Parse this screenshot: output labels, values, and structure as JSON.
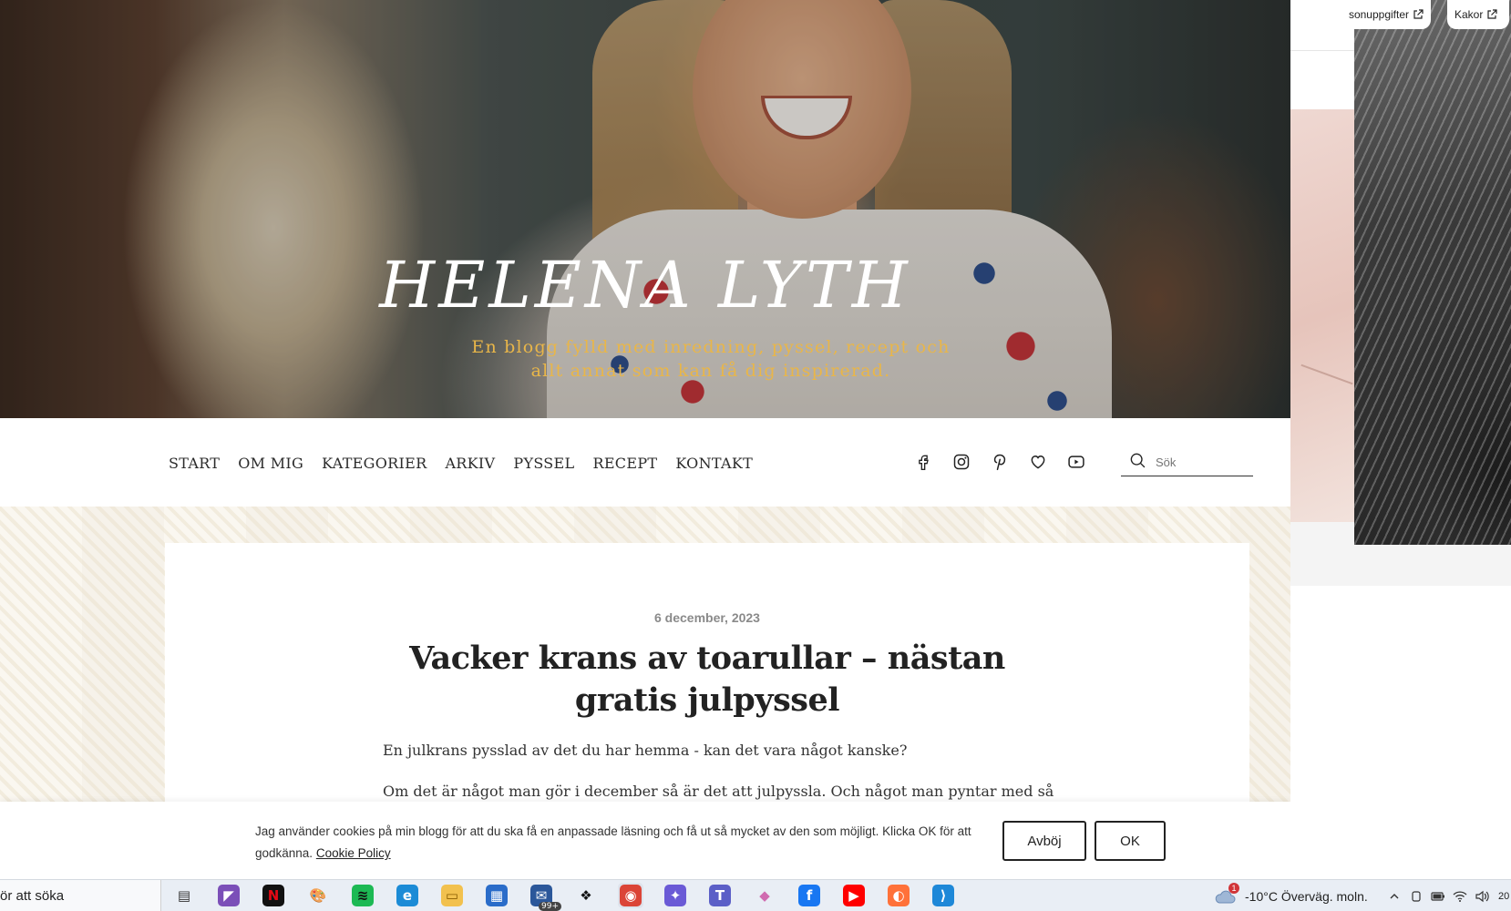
{
  "site": {
    "title": "HELENA LYTH",
    "tagline": "En blogg fylld med inredning, pyssel, recept och allt annat som kan få dig inspirerad."
  },
  "nav": {
    "items": [
      "START",
      "OM MIG",
      "KATEGORIER",
      "ARKIV",
      "PYSSEL",
      "RECEPT",
      "KONTAKT"
    ],
    "social_icons": [
      "facebook-icon",
      "instagram-icon",
      "pinterest-icon",
      "heart-icon",
      "youtube-icon"
    ],
    "search_placeholder": "Sök"
  },
  "post": {
    "date": "6 december, 2023",
    "title": "Vacker krans av toarullar – nästan gratis julpyssel",
    "paragraphs": [
      "En julkrans pysslad av det du har hemma - kan det vara något kanske?",
      "Om det är något man gör i december så är det att julpyssla. Och något man pyntar med så är"
    ]
  },
  "cookie": {
    "text": "Jag använder cookies på min blogg för att du ska få en anpassade läsning och få ut så mycket av den som möjligt. Klicka OK för att godkänna.",
    "link": "Cookie Policy",
    "reject_label": "Avböj",
    "ok_label": "OK"
  },
  "background_page": {
    "tab_left": "sonuppgifter",
    "tab_right": "Kakor"
  },
  "taskbar": {
    "search_text": "ör att söka",
    "apps": [
      {
        "name": "task-view-icon",
        "color": "#e9eef5",
        "glyph": "▤",
        "fg": "#333"
      },
      {
        "name": "visual-studio-icon",
        "color": "#7b4fb8",
        "glyph": "◤",
        "fg": "#fff"
      },
      {
        "name": "netflix-icon",
        "color": "#111111",
        "glyph": "N",
        "fg": "#e50914"
      },
      {
        "name": "paint-icon",
        "color": "#e9eef5",
        "glyph": "🎨",
        "fg": "#333"
      },
      {
        "name": "spotify-icon",
        "color": "#1db954",
        "glyph": "≋",
        "fg": "#111"
      },
      {
        "name": "edge-icon",
        "color": "#1b8bd6",
        "glyph": "e",
        "fg": "#fff"
      },
      {
        "name": "file-explorer-icon",
        "color": "#f2c14e",
        "glyph": "▭",
        "fg": "#8a5d00"
      },
      {
        "name": "store-icon",
        "color": "#2a6cc9",
        "glyph": "▦",
        "fg": "#fff"
      },
      {
        "name": "mail-icon",
        "color": "#2b579a",
        "glyph": "✉",
        "fg": "#fff",
        "badge": "99+"
      },
      {
        "name": "dropbox-icon",
        "color": "#e9eef5",
        "glyph": "❖",
        "fg": "#111"
      },
      {
        "name": "chrome-icon",
        "color": "#db4437",
        "glyph": "◉",
        "fg": "#fff",
        "active": true
      },
      {
        "name": "copilot-icon",
        "color": "#6a5ad6",
        "glyph": "✦",
        "fg": "#fff"
      },
      {
        "name": "teams-icon",
        "color": "#5b5fc7",
        "glyph": "T",
        "fg": "#fff"
      },
      {
        "name": "photos-icon",
        "color": "#e9eef5",
        "glyph": "◆",
        "fg": "#d06bb0"
      },
      {
        "name": "facebook-app-icon",
        "color": "#1877f2",
        "glyph": "f",
        "fg": "#fff"
      },
      {
        "name": "youtube-app-icon",
        "color": "#ff0000",
        "glyph": "▶",
        "fg": "#fff"
      },
      {
        "name": "firefox-icon",
        "color": "#ff7139",
        "glyph": "◐",
        "fg": "#fff"
      },
      {
        "name": "vscode-icon",
        "color": "#1e88d8",
        "glyph": "⟩",
        "fg": "#fff"
      }
    ],
    "weather_alert": "1",
    "weather": "-10°C  Överväg. moln.",
    "clock": "20"
  }
}
